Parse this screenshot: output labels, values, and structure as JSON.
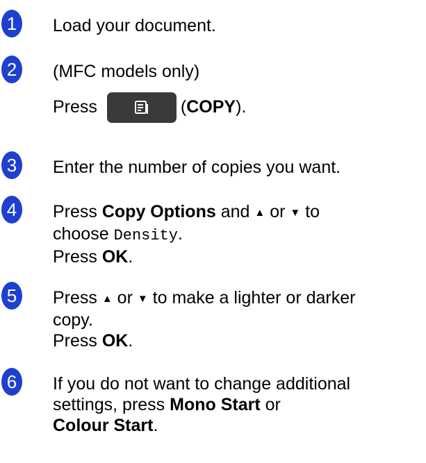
{
  "steps": [
    {
      "num": "1",
      "text": "Load your document."
    },
    {
      "num": "2",
      "line1": "(MFC models only)",
      "press": "Press",
      "open_paren": "(",
      "copy_label": "COPY",
      "close": ")."
    },
    {
      "num": "3",
      "text": "Enter the number of copies you want."
    },
    {
      "num": "4",
      "press": "Press",
      "button": "Copy Options",
      "and": "and",
      "up": "▲",
      "or": "or",
      "down": "▼",
      "to": "to",
      "choose": "choose",
      "option": "Density",
      "period": ".",
      "press2": "Press",
      "ok": "OK",
      "period2": "."
    },
    {
      "num": "5",
      "press": "Press",
      "up": "▲",
      "or": "or",
      "down": "▼",
      "rest": "to make a lighter or darker",
      "line2": "copy.",
      "press2": "Press",
      "ok": "OK",
      "period2": "."
    },
    {
      "num": "6",
      "line1": "If you do not want to change additional",
      "settings": "settings, press",
      "mono": "Mono Start",
      "or": "or",
      "colour": "Colour Start",
      "period": "."
    }
  ],
  "icons": {
    "copy_button_icon": "copy-icon"
  }
}
